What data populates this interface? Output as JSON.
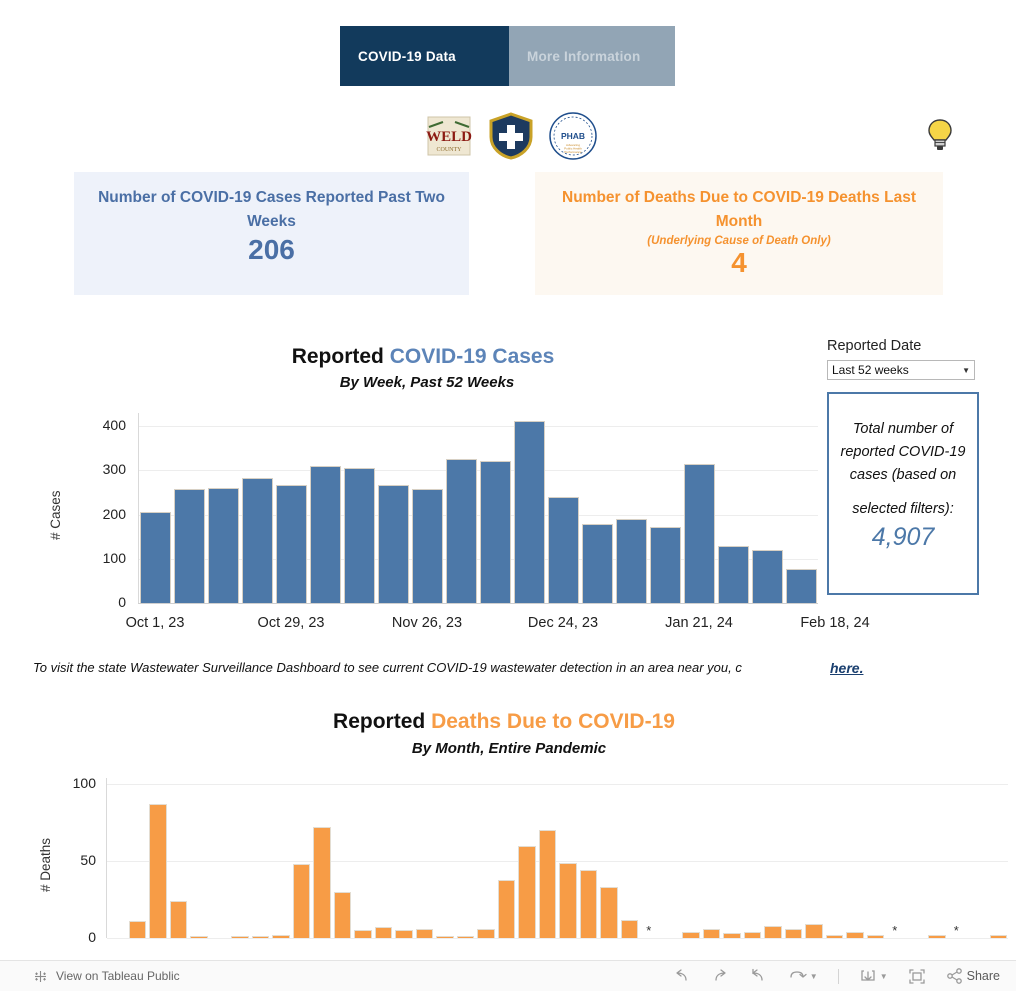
{
  "tabs": [
    {
      "label": "COVID-19 Data",
      "active": true
    },
    {
      "label": "More Information",
      "active": false
    }
  ],
  "logos": [
    {
      "name": "weld-county-logo",
      "text": "WELD"
    },
    {
      "name": "health-shield-logo",
      "text": ""
    },
    {
      "name": "phab-accreditation-logo",
      "text": "PHAB"
    }
  ],
  "bulb_icon": "lightbulb-icon",
  "kpi": {
    "cases": {
      "title": "Number of COVID-19 Cases Reported Past Two Weeks",
      "value": "206",
      "color": "#4a6fa5",
      "background": "#eef2fa"
    },
    "deaths": {
      "title": "Number of Deaths Due to COVID-19 Deaths Last Month",
      "subtitle": "(Underlying Cause of Death Only)",
      "value": "4",
      "color": "#f5922f",
      "background": "#fdf8f1"
    }
  },
  "cases_chart_heading": {
    "title_plain": "Reported ",
    "title_accent": "COVID-19 Cases",
    "subtitle": "By Week, Past 52 Weeks"
  },
  "deaths_chart_heading": {
    "title_plain": "Reported ",
    "title_accent": "Deaths Due to COVID-19",
    "subtitle": "By Month, Entire Pandemic"
  },
  "filter": {
    "label": "Reported Date",
    "value": "Last 52 weeks",
    "options": [
      "Last 52 weeks"
    ],
    "caret": "chevron-down-icon"
  },
  "total_box": {
    "line1": "Total number of reported COVID-19 cases (based on",
    "line2": "selected filters):",
    "value": "4,907",
    "color": "#4c78a8"
  },
  "wastewater": {
    "text": "To visit the state Wastewater Surveillance Dashboard to see current COVID-19 wastewater detection in an area near you, c",
    "link": "here."
  },
  "toolbar": {
    "tableau_label": "View on Tableau Public",
    "tableau_icon": "tableau-logo-icon",
    "buttons": [
      {
        "name": "undo-button",
        "icon": "undo-icon",
        "label": ""
      },
      {
        "name": "redo-button",
        "icon": "redo-icon",
        "label": ""
      },
      {
        "name": "revert-button",
        "icon": "revert-icon",
        "label": ""
      },
      {
        "name": "refresh-button",
        "icon": "refresh-icon",
        "label": ""
      },
      {
        "name": "download-button",
        "icon": "download-icon",
        "label": ""
      },
      {
        "name": "fullscreen-button",
        "icon": "fullscreen-icon",
        "label": ""
      },
      {
        "name": "share-button",
        "icon": "share-icon",
        "label": "Share"
      }
    ],
    "share_label": "Share"
  },
  "chart_data": [
    {
      "type": "bar",
      "name": "reported-covid-cases-by-week",
      "title": "Reported COVID-19 Cases",
      "subtitle": "By Week, Past 52 Weeks",
      "xlabel": "",
      "ylabel": "# Cases",
      "ylim": [
        0,
        430
      ],
      "yticks": [
        0,
        100,
        200,
        300,
        400
      ],
      "grid": true,
      "bar_color": "#4c78a8",
      "xtick_labels": [
        "Oct 1, 23",
        "Oct 29, 23",
        "Nov 26, 23",
        "Dec 24, 23",
        "Jan 21, 24",
        "Feb 18, 24"
      ],
      "xtick_indices": [
        0,
        4,
        8,
        12,
        16,
        20
      ],
      "categories": [
        "Oct 1, 23",
        "Oct 8, 23",
        "Oct 15, 23",
        "Oct 22, 23",
        "Oct 29, 23",
        "Nov 5, 23",
        "Nov 12, 23",
        "Nov 19, 23",
        "Nov 26, 23",
        "Dec 3, 23",
        "Dec 10, 23",
        "Dec 17, 23",
        "Dec 24, 23",
        "Dec 31, 23",
        "Jan 7, 24",
        "Jan 14, 24",
        "Jan 21, 24",
        "Jan 28, 24",
        "Feb 4, 24",
        "Feb 11, 24",
        "Feb 18, 24"
      ],
      "values": [
        206,
        257,
        261,
        282,
        268,
        309,
        305,
        268,
        259,
        326,
        321,
        412,
        239,
        178,
        190,
        172,
        314,
        130,
        120,
        76
      ]
    },
    {
      "type": "bar",
      "name": "reported-deaths-by-month",
      "title": "Reported Deaths Due to COVID-19",
      "subtitle": "By Month, Entire Pandemic",
      "xlabel": "",
      "ylabel": "# Deaths",
      "ylim": [
        0,
        104
      ],
      "yticks": [
        0,
        50,
        100
      ],
      "grid": true,
      "bar_color": "#f79c46",
      "suppressed_marker": "*",
      "values": [
        0,
        11,
        87,
        24,
        1,
        0,
        1,
        1,
        2,
        48,
        72,
        30,
        5,
        7,
        5,
        6,
        1,
        1,
        6,
        38,
        60,
        70,
        49,
        44,
        33,
        12,
        0,
        0,
        4,
        6,
        3,
        4,
        8,
        6,
        9,
        2,
        4,
        2,
        0,
        0,
        2,
        0,
        0,
        2
      ],
      "suppressed_indices": [
        26,
        38,
        41
      ]
    }
  ]
}
